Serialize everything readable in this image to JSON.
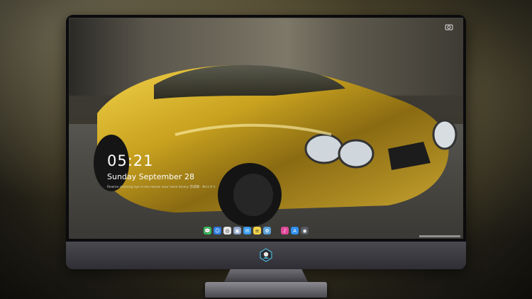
{
  "lock_screen": {
    "time": "05:21",
    "date": "Sunday September  28",
    "caption": "Rewine stunnng eye sr.ess noune vour loom binary 宫城镇 - 8rcs tr's"
  },
  "dock": {
    "apps": [
      {
        "name": "messages",
        "color": "#34c759",
        "glyph": "💬"
      },
      {
        "name": "finder",
        "color": "#2f7de1",
        "glyph": "☺"
      },
      {
        "name": "safari",
        "color": "#e6e6e6",
        "glyph": "◎"
      },
      {
        "name": "preview",
        "color": "#8fa6c8",
        "glyph": "▣"
      },
      {
        "name": "mail",
        "color": "#3c9cf0",
        "glyph": "✉"
      },
      {
        "name": "notes",
        "color": "#f5d44a",
        "glyph": "≡"
      },
      {
        "name": "photos",
        "color": "#5aa0d8",
        "glyph": "✿"
      },
      {
        "name": "music",
        "color": "#e04a9b",
        "glyph": "♪"
      },
      {
        "name": "app-store",
        "color": "#2f8ff0",
        "glyph": "A"
      },
      {
        "name": "camera",
        "color": "#555a60",
        "glyph": "◉"
      }
    ]
  },
  "colors": {
    "car_gold": "#c9a21f",
    "logo_blue": "#4fb6d8"
  }
}
